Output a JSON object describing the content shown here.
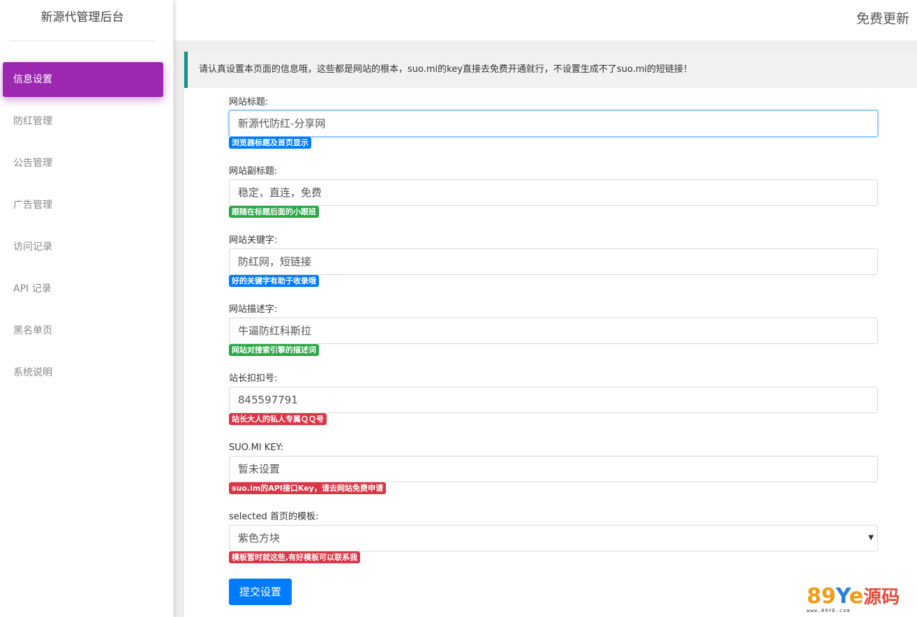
{
  "brand": {
    "title": "新源代管理后台"
  },
  "topbar": {
    "right_link": "免费更新"
  },
  "sidebar": {
    "items": [
      {
        "label": "信息设置",
        "active": true
      },
      {
        "label": "防红管理"
      },
      {
        "label": "公告管理"
      },
      {
        "label": "广告管理"
      },
      {
        "label": "访问记录"
      },
      {
        "label": "API 记录"
      },
      {
        "label": "黑名单页"
      },
      {
        "label": "系统说明"
      }
    ]
  },
  "notice": {
    "text": "请认真设置本页面的信息哦，这些都是网站的根本，suo.mi的key直接去免费开通就行，不设置生成不了suo.mi的短链接！"
  },
  "form": {
    "site_title": {
      "label": "网站标题:",
      "value": "新源代防红-分享网",
      "hint": "浏览器标题及首页显示"
    },
    "site_subtitle": {
      "label": "网站副标题:",
      "value": "稳定，直连，免费",
      "hint": "跟随在标题后面的小跟班"
    },
    "site_keywords": {
      "label": "网站关键字:",
      "value": "防红网，短链接",
      "hint": "好的关键字有助于收录哦"
    },
    "site_description": {
      "label": "网站描述字:",
      "value": "牛逼防红科斯拉",
      "hint": "网站对搜索引擎的描述词"
    },
    "owner_qq": {
      "label": "站长扣扣号:",
      "value": "845597791",
      "hint": "站长大人的私人专属ＱＱ号"
    },
    "suo_key": {
      "label": "SUO.MI KEY:",
      "value": "暂未设置",
      "hint": "suo.im的API接口Key，请去网站免费申请"
    },
    "template": {
      "label": "selected 首页的模板:",
      "selected": "紫色方块",
      "hint": "模板暂时就这些,有好模板可以联系我"
    },
    "submit_label": "提交设置"
  },
  "watermark": {
    "logo_a": "89",
    "logo_b": "Y",
    "logo_c": "e",
    "logo_cn": "源码",
    "url": "www.89YE.com"
  },
  "colors": {
    "active_nav": "#9c27b0",
    "primary": "#007bff",
    "success": "#28a745",
    "danger": "#dc3545",
    "notice_border": "#139487"
  }
}
